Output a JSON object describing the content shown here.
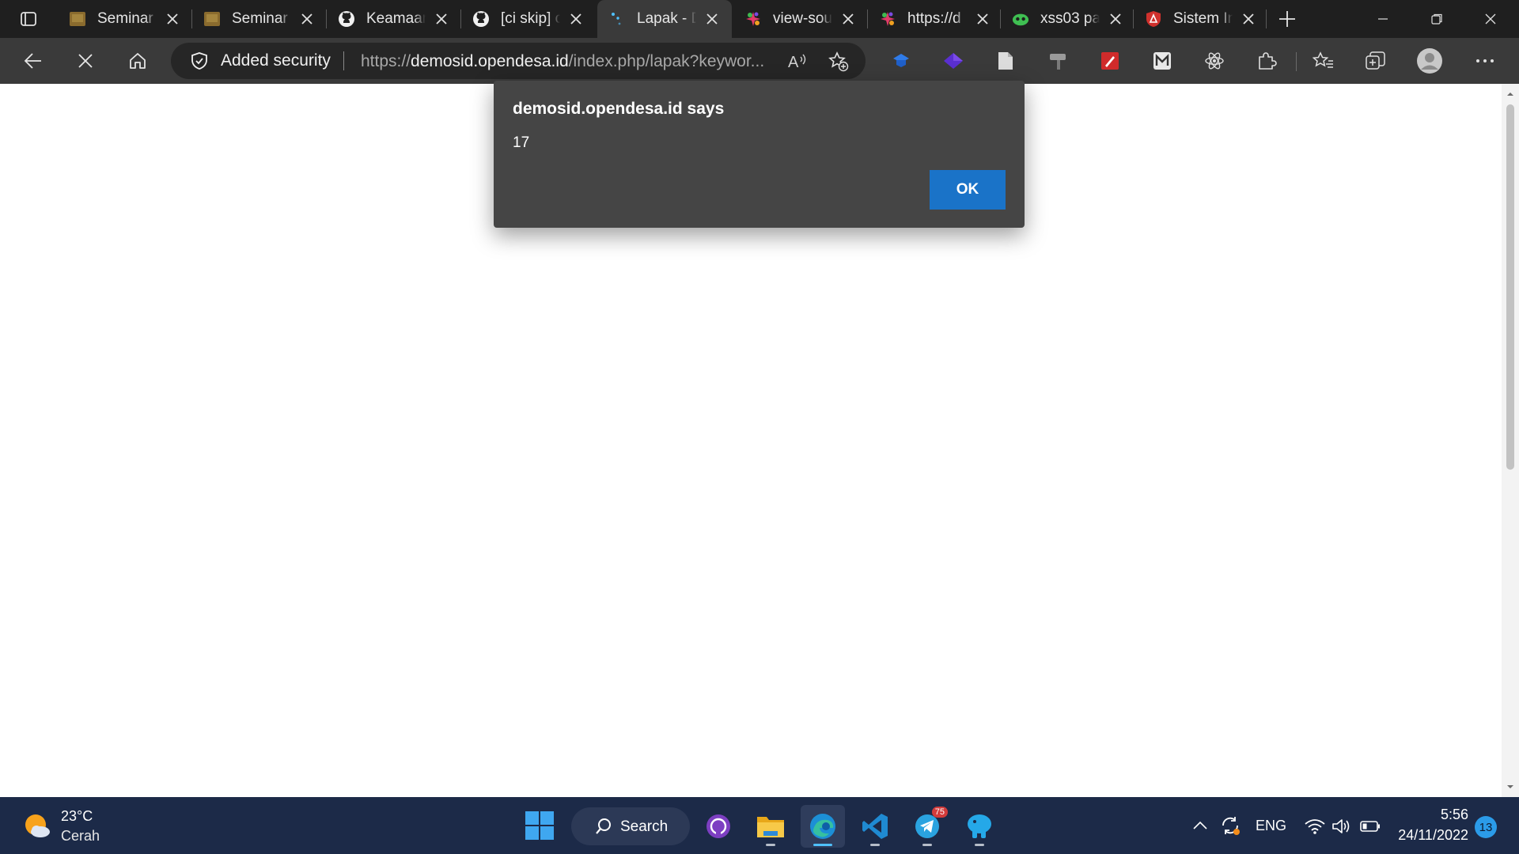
{
  "browser": {
    "tabs": [
      {
        "title": "Seminar",
        "favicon": "seminar-favicon",
        "active": false
      },
      {
        "title": "Seminar",
        "favicon": "seminar-favicon",
        "active": false
      },
      {
        "title": "Keamaan",
        "favicon": "github-icon",
        "active": false
      },
      {
        "title": "[ci skip] c",
        "favicon": "github-icon",
        "active": false
      },
      {
        "title": "Lapak - D",
        "favicon": "opendesa-icon",
        "active": true
      },
      {
        "title": "view-sou",
        "favicon": "opendesa-icon",
        "active": false
      },
      {
        "title": "https://d",
        "favicon": "opendesa-icon",
        "active": false
      },
      {
        "title": "xss03 pa",
        "favicon": "hack-icon",
        "active": false
      },
      {
        "title": "Sistem In",
        "favicon": "shield-red-icon",
        "active": false
      }
    ],
    "security_label": "Added security",
    "url_prefix": "https://",
    "url_host": "demosid.opendesa.id",
    "url_path": "/index.php/lapak?keywor...",
    "accent_color": "#1a73c8"
  },
  "dialog": {
    "title": "demosid.opendesa.id says",
    "message": "17",
    "ok_label": "OK"
  },
  "taskbar": {
    "weather_temp": "23°C",
    "weather_desc": "Cerah",
    "search_label": "Search",
    "telegram_badge": "75",
    "language": "ENG",
    "time": "5:56",
    "date": "24/11/2022",
    "notifications": "13"
  }
}
